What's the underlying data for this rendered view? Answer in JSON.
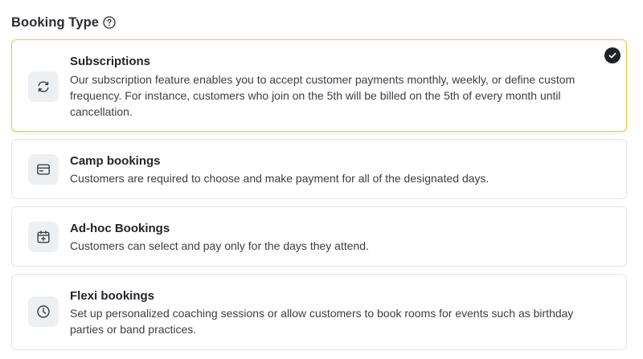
{
  "section": {
    "title": "Booking Type",
    "help_icon": "question-circle-icon"
  },
  "booking_types": [
    {
      "title": "Subscriptions",
      "description": "Our subscription feature enables you to accept customer payments monthly, weekly, or define custom frequency. For instance, customers who join on the 5th will be billed on the 5th of every month until cancellation.",
      "icon": "refresh-cycle-icon",
      "selected": true
    },
    {
      "title": "Camp bookings",
      "description": "Customers are required to choose and make payment for all of the designated days.",
      "icon": "card-icon",
      "selected": false
    },
    {
      "title": "Ad-hoc Bookings",
      "description": "Customers can select and pay only for the days they attend.",
      "icon": "calendar-plus-icon",
      "selected": false
    },
    {
      "title": "Flexi bookings",
      "description": "Set up personalized coaching sessions or allow customers to book rooms for events such as birthday parties or band practices.",
      "icon": "clock-icon",
      "selected": false
    }
  ],
  "colors": {
    "selected_border": "#eec547",
    "icon_bg": "#edf0f3",
    "check_bg": "#1f2329"
  }
}
